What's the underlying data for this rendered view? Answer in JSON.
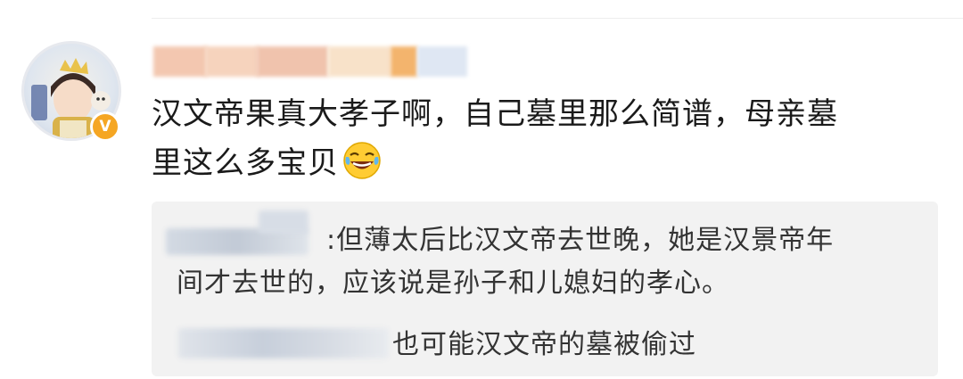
{
  "comment": {
    "text_line1": "汉文帝果真大孝子啊，自己墓里那么简谱，母亲墓",
    "text_line2": "里这么多宝贝",
    "emoji": "laughing-tears-emoji"
  },
  "replies": [
    {
      "colon": ":",
      "text_line1": "但薄太后比汉文帝去世晚，她是汉景帝年",
      "text_line2": "间才去世的，应该说是孙子和儿媳妇的孝心。"
    },
    {
      "text": "也可能汉文帝的墓被偷过"
    }
  ],
  "colors": {
    "badge": "#f5a623",
    "reply_background": "#f2f2f2",
    "text": "#1a1a1a"
  }
}
